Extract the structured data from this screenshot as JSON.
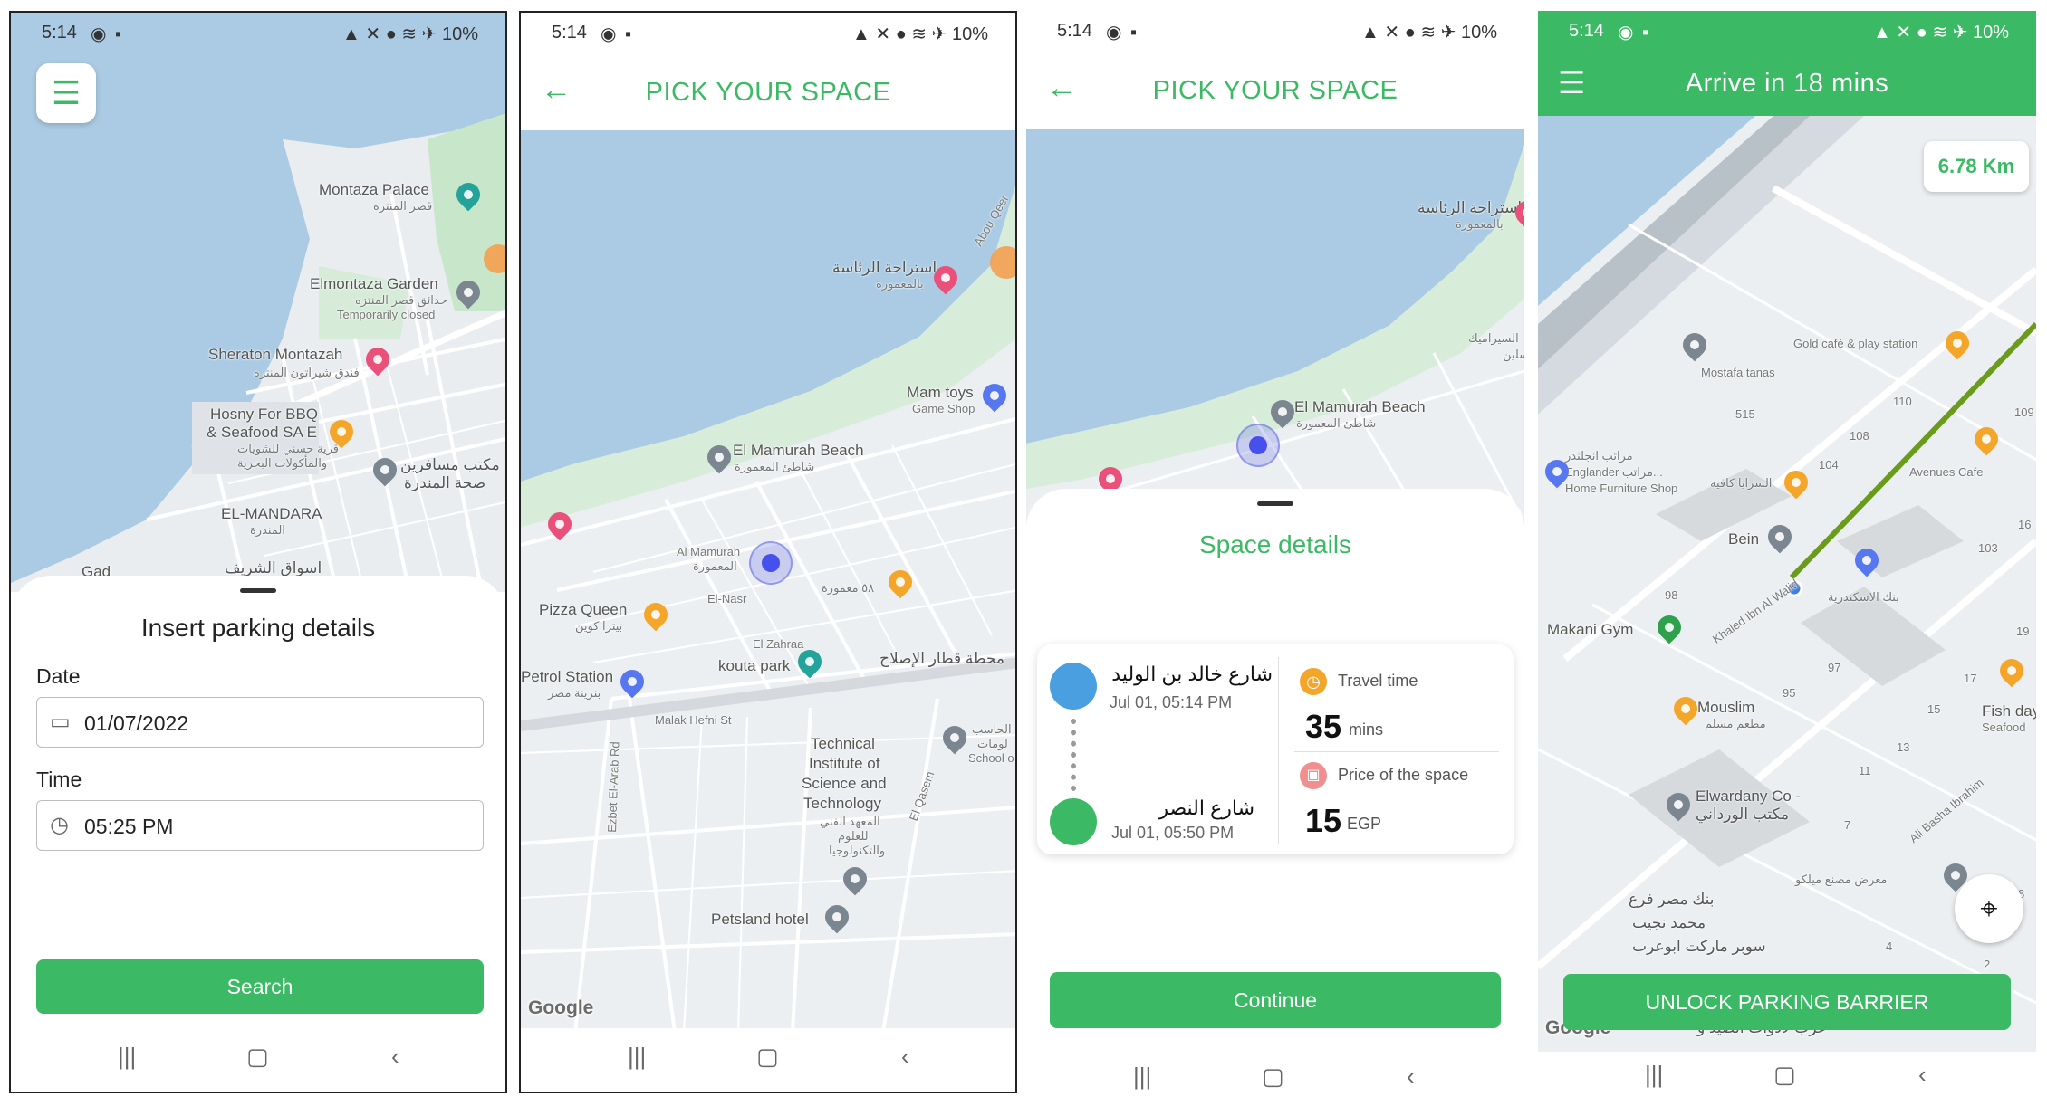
{
  "status": {
    "time": "5:14",
    "battery": "10%"
  },
  "screen1": {
    "map_labels": [
      "Montaza Palace",
      "قصر المنتزه",
      "Elmontaza Garden",
      "حدائق قصر المنتزه",
      "Temporarily closed",
      "Sheraton Montazah",
      "فندق شيراتون المنتزه",
      "Hosny For BBQ",
      "& Seafood SA E",
      "قرية حسني للشويات",
      "والمأكولات البحرية",
      "مكتب مسافرين",
      "صحة المندرة",
      "EL-MANDARA",
      "المندرة",
      "Gad",
      "اسواق الشريف"
    ],
    "sheet_title": "Insert parking details",
    "date_label": "Date",
    "date_value": "01/07/2022",
    "time_label": "Time",
    "time_value": "05:25 PM",
    "search_button": "Search"
  },
  "screen2": {
    "title": "PICK YOUR SPACE",
    "map_labels": [
      "استراحة الرئاسة",
      "بالمعمورة",
      "Mam toys",
      "Game Shop",
      "El Mamurah Beach",
      "شاطئ المعمورة",
      "Al Mamurah",
      "المعمورة",
      "El-Nasr",
      "٥٨ معمورة",
      "Pizza Queen",
      "بيتزا كوين",
      "kouta park",
      "El Zahraa",
      "محطة قطار الإصلاح",
      "Petrol Station",
      "بنزينة مصر",
      "Malak Hefni St",
      "Technical",
      "Institute of",
      "Science and",
      "Technology",
      "المعهد الفني",
      "للعلوم",
      "والتكنولوجيا",
      "Petsland hotel",
      "الحاسب",
      "لومات",
      "School o",
      "Abou Qeer",
      "Ezbet El-Arab Rd",
      "El Qasem"
    ],
    "google": "Google"
  },
  "screen3": {
    "title": "PICK YOUR SPACE",
    "map_labels": [
      "استراحة الرئاسة",
      "بالمعمورة",
      "El Mamurah Beach",
      "شاطئ المعمورة",
      "السيراميك",
      "سلين"
    ],
    "sheet_title": "Space details",
    "from_name": "شارع خالد بن الوليد",
    "from_time": "Jul 01, 05:14 PM",
    "to_name": "شارع النصر",
    "to_time": "Jul 01, 05:50 PM",
    "travel_label": "Travel time",
    "travel_value": "35",
    "travel_unit": "mins",
    "price_label": "Price of the space",
    "price_value": "15",
    "price_unit": "EGP",
    "continue_button": "Continue"
  },
  "screen4": {
    "title": "Arrive in 18 mins",
    "distance": "6.78 Km",
    "map_labels": [
      "Mostafa tanas",
      "Gold café & play station",
      "مراتب انجلندر",
      "Englander مراتب...",
      "Home Furniture Shop",
      "السرايا كافيه",
      "Avenues Cafe",
      "Bein",
      "بنك الاسكندرية",
      "Makani Gym",
      "Khaled Ibn Al Walid",
      "Mouslim",
      "مطعم مسلم",
      "Fish day",
      "Seafood",
      "Elwardany Co -",
      "مكتب الورداني",
      "Ali Basha Ibrahim",
      "معرض مصنع ميلكو",
      "بنك مصر فرع",
      "محمد نجيب",
      "سوبر ماركت ابوعرب",
      "عزب لأدوات الصيد و"
    ],
    "numbers": [
      "515",
      "110",
      "109",
      "108",
      "104",
      "103",
      "16",
      "98",
      "97",
      "95",
      "19",
      "17",
      "15",
      "13",
      "11",
      "7",
      "8",
      "4",
      "2"
    ],
    "unlock_button": "UNLOCK PARKING BARRIER",
    "google": "Google"
  }
}
